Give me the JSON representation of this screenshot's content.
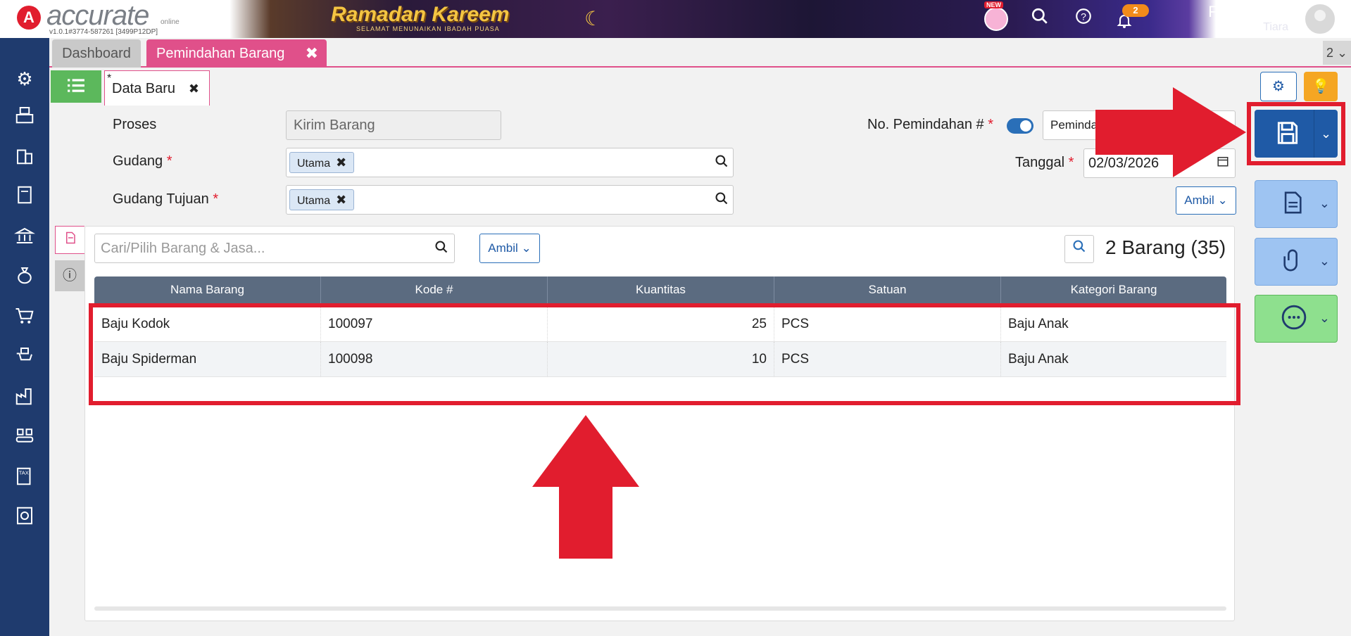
{
  "app": {
    "logo_text": "accurate",
    "logo_sub": "online",
    "version": "v1.0.1#3774-587261 [3499P12DP]",
    "banner_title": "Ramadan Kareem",
    "banner_sub": "SELAMAT MENUNAIKAN IBADAH PUASA",
    "new_tag": "NEW",
    "notification_count": "2",
    "company": "Fifi Fashion",
    "user": "Tiara"
  },
  "tabs": {
    "dashboard": "Dashboard",
    "active": "Pemindahan Barang",
    "count": "2 ⌄"
  },
  "form": {
    "tab_label": "Data Baru",
    "tab_modified": "*",
    "proses_label": "Proses",
    "proses_value": "Kirim Barang",
    "gudang_label": "Gudang",
    "gudang_chip": "Utama",
    "gudang_tujuan_label": "Gudang Tujuan",
    "gudang_tujuan_chip": "Utama",
    "no_label": "No. Pemindahan #",
    "no_value": "Pemindahan",
    "tanggal_label": "Tanggal",
    "tanggal_value": "02/03/2026",
    "ambil": "Ambil",
    "required_mark": "*"
  },
  "detail": {
    "search_placeholder": "Cari/Pilih Barang & Jasa...",
    "ambil": "Ambil",
    "count_label": "2 Barang (35)",
    "columns": [
      "Nama Barang",
      "Kode #",
      "Kuantitas",
      "Satuan",
      "Kategori Barang"
    ],
    "rows": [
      {
        "nama": "Baju Kodok",
        "kode": "100097",
        "qty": "25",
        "satuan": "PCS",
        "kategori": "Baju Anak"
      },
      {
        "nama": "Baju Spiderman",
        "kode": "100098",
        "qty": "10",
        "satuan": "PCS",
        "kategori": "Baju Anak"
      }
    ]
  },
  "colors": {
    "accent_pink": "#e0508a",
    "primary_blue": "#1f5aa6",
    "sidebar": "#1f3b6e",
    "annotation_red": "#e11d2e"
  },
  "icons": {
    "sidebar": [
      "gear-icon",
      "cashier-icon",
      "building-icon",
      "book-icon",
      "bank-icon",
      "money-bag-icon",
      "cart-icon",
      "cart-box-icon",
      "factory-icon",
      "conveyor-icon",
      "tax-icon",
      "report-icon"
    ]
  }
}
